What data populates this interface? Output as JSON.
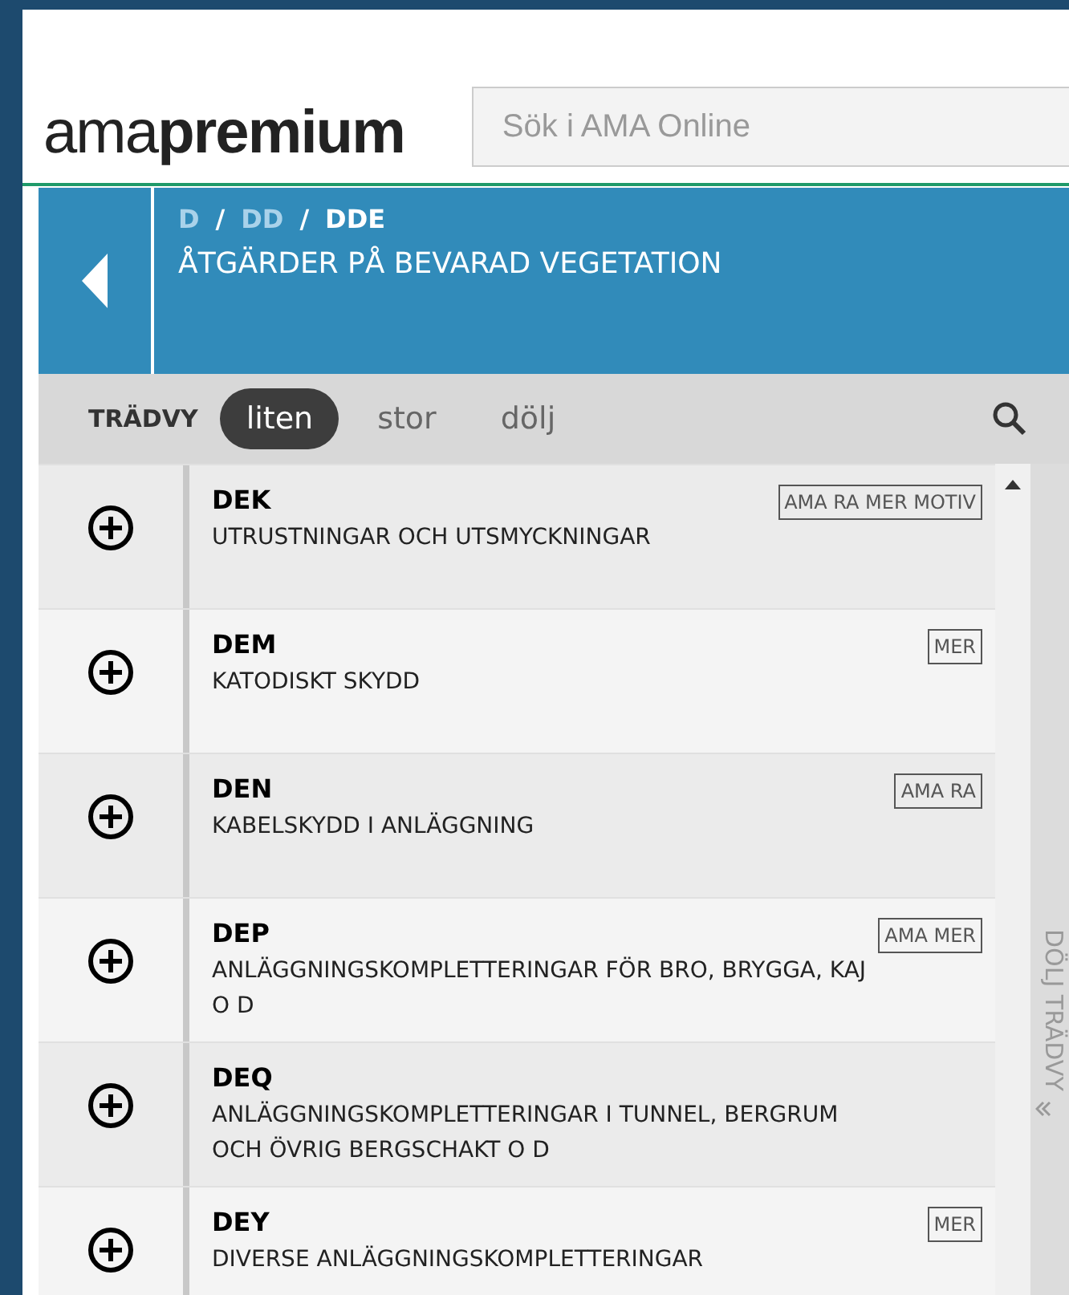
{
  "header": {
    "logo_light": "ama",
    "logo_bold": "premium",
    "search": {
      "placeholder": "Sök i AMA Online"
    }
  },
  "breadcrumb": [
    {
      "label": "D",
      "current": false
    },
    {
      "label": "DD",
      "current": false
    },
    {
      "label": "DDE",
      "current": true
    }
  ],
  "breadcrumb_separator": "/",
  "section_title": "ÅTGÄRDER PÅ BEVARAD VEGETATION",
  "toolbar": {
    "label": "TRÄDVY",
    "tabs": [
      {
        "label": "liten",
        "selected": true
      },
      {
        "label": "stor",
        "selected": false
      },
      {
        "label": "dölj",
        "selected": false
      }
    ]
  },
  "rows": [
    {
      "code": "DEK",
      "title": "UTRUSTNINGAR OCH UTSMYCKNINGAR",
      "tags": "AMA RA MER MOTIV"
    },
    {
      "code": "DEM",
      "title": "KATODISKT SKYDD",
      "tags": "MER"
    },
    {
      "code": "DEN",
      "title": "KABELSKYDD I ANLÄGGNING",
      "tags": "AMA RA"
    },
    {
      "code": "DEP",
      "title": "ANLÄGGNINGSKOMPLETTERINGAR FÖR BRO, BRYGGA, KAJ O D",
      "tags": "AMA MER"
    },
    {
      "code": "DEQ",
      "title": "ANLÄGGNINGSKOMPLETTERINGAR I TUNNEL, BERGRUM OCH ÖVRIG BERGSCHAKT O D"
    },
    {
      "code": "DEY",
      "title": "DIVERSE ANLÄGGNINGSKOMPLETTERINGAR",
      "tags": "MER"
    }
  ],
  "side_toggle": "DÖLJ TRÄDVY"
}
